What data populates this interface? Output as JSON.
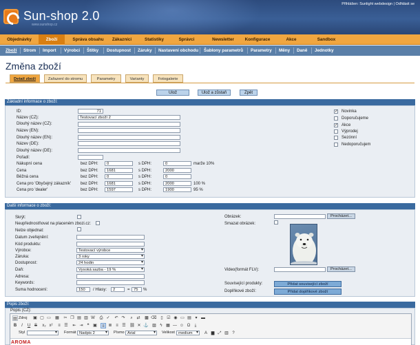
{
  "header": {
    "brand": "Sun-shop 2.0",
    "brand_url": "www.sunshop.cz",
    "login_text": "Přihlášen: Sunlight webdesign",
    "divider": " | ",
    "logout": "Odhlásit se"
  },
  "menu1": [
    "Objednávky",
    "Zboží",
    "Správa obsahu",
    "Zákazníci",
    "Statistiky",
    "Správci",
    "Newsletter",
    "Konfigurace",
    "Akce",
    "Sandbox"
  ],
  "menu1_active": "Zboží",
  "menu2": [
    "Zboží",
    "Strom",
    "Import",
    "Výrobci",
    "Štítky",
    "Dostupnost",
    "Záruky",
    "Nastavení obchodu",
    "Šablony parametrů",
    "Parametry",
    "Měny",
    "Daně",
    "Jednotky"
  ],
  "page_title": "Změna zboží",
  "tabs": [
    "Detail zboží",
    "Zařazení do stromu",
    "Parametry",
    "Varianty",
    "Fotogalerie"
  ],
  "actions": {
    "save": "Ulož",
    "save_stay": "Ulož a zůstaň",
    "back": "Zpět"
  },
  "section_basic": {
    "title": "Základní informace o zboží:",
    "id_label": "ID:",
    "id_value": "71",
    "fields": [
      {
        "label": "Název (CZ):",
        "value": "Testovací zboží 2"
      },
      {
        "label": "Dlouhý název (CZ):",
        "value": ""
      },
      {
        "label": "Název (EN):",
        "value": ""
      },
      {
        "label": "Dlouhý název (EN):",
        "value": ""
      },
      {
        "label": "Název (DE):",
        "value": ""
      },
      {
        "label": "Dlouhý název (DE):",
        "value": ""
      }
    ],
    "poradi_label": "Pořadí:",
    "prices": [
      {
        "label": "Nákupní cena",
        "bez_label": "bez DPH:",
        "bez": "0",
        "s_label": "s DPH:",
        "s": "0",
        "extra": "marže 10%"
      },
      {
        "label": "Cena",
        "bez_label": "bez DPH:",
        "bez": "1681",
        "s_label": "s DPH:",
        "s": "2000",
        "extra": ""
      },
      {
        "label": "Běžná cena",
        "bez_label": "bez DPH:",
        "bez": "0",
        "s_label": "s DPH:",
        "s": "0",
        "extra": ""
      },
      {
        "label": "Cena pro 'Obyčejný zákazník'",
        "bez_label": "bez DPH:",
        "bez": "1681",
        "s_label": "s DPH:",
        "s": "2000",
        "extra": "100 %"
      },
      {
        "label": "Cena pro 'dealer'",
        "bez_label": "bez DPH:",
        "bez": "1597",
        "s_label": "s DPH:",
        "s": "1900",
        "extra": "95 %"
      }
    ],
    "flags": [
      {
        "label": "Novinka",
        "checked": true
      },
      {
        "label": "Doporučujeme",
        "checked": false
      },
      {
        "label": "Akce",
        "checked": true
      },
      {
        "label": "Výprodej",
        "checked": false
      },
      {
        "label": "Sezónní",
        "checked": false
      },
      {
        "label": "Nedoporučujem",
        "checked": false
      }
    ]
  },
  "section_more": {
    "title": "Další informace o zboží:",
    "skryt": "Skrýt:",
    "neuprednost": "Neupřednostňovat na placeném zbozi.cz:",
    "nelze": "Nelze objednat:",
    "datum": "Datum zveřejnění:",
    "kod": "Kód produktu:",
    "vyrobce_label": "Výrobce:",
    "vyrobce_value": "Testovací výrobce",
    "zaruka_label": "Záruka:",
    "zaruka_value": "3 roky",
    "dostupnost_label": "Dostupnost:",
    "dostupnost_value": "24 hodin",
    "dan_label": "Daň:",
    "dan_value": "Vysoká sazba - 19 %",
    "adresa": "Adresa:",
    "keywords": "Keywords:",
    "hodnoceni_label": "Suma hodnocení:",
    "hodnoceni_value": "150",
    "hlasy_label": "/ Hlasy:",
    "hlasy_value": "2",
    "eq": "=",
    "pct_value": "75",
    "pct_sign": "%",
    "obrazek": "Obrázek:",
    "prochazet": "Procházet...",
    "smazat": "Smazat obrázek:",
    "video": "Video(formát FLV):",
    "souvisejici_label": "Související produkty:",
    "souvisejici_btn": "Přidat související zboží",
    "doplnkove_label": "Doplňkové zboží:",
    "doplnkove_btn": "Přidat doplňkové zboží"
  },
  "section_desc": {
    "title": "Popis zboží:",
    "popis_label": "Popis (CZ):",
    "toolbar": {
      "zdroj": "Zdroj",
      "styl_label": "Styl",
      "format_label": "Formát",
      "format_value": "Nadpis 2",
      "pismo_label": "Písmo",
      "pismo_value": "Arial",
      "velikost_label": "Velikost",
      "velikost_value": "medium"
    },
    "content": "AROMA"
  }
}
